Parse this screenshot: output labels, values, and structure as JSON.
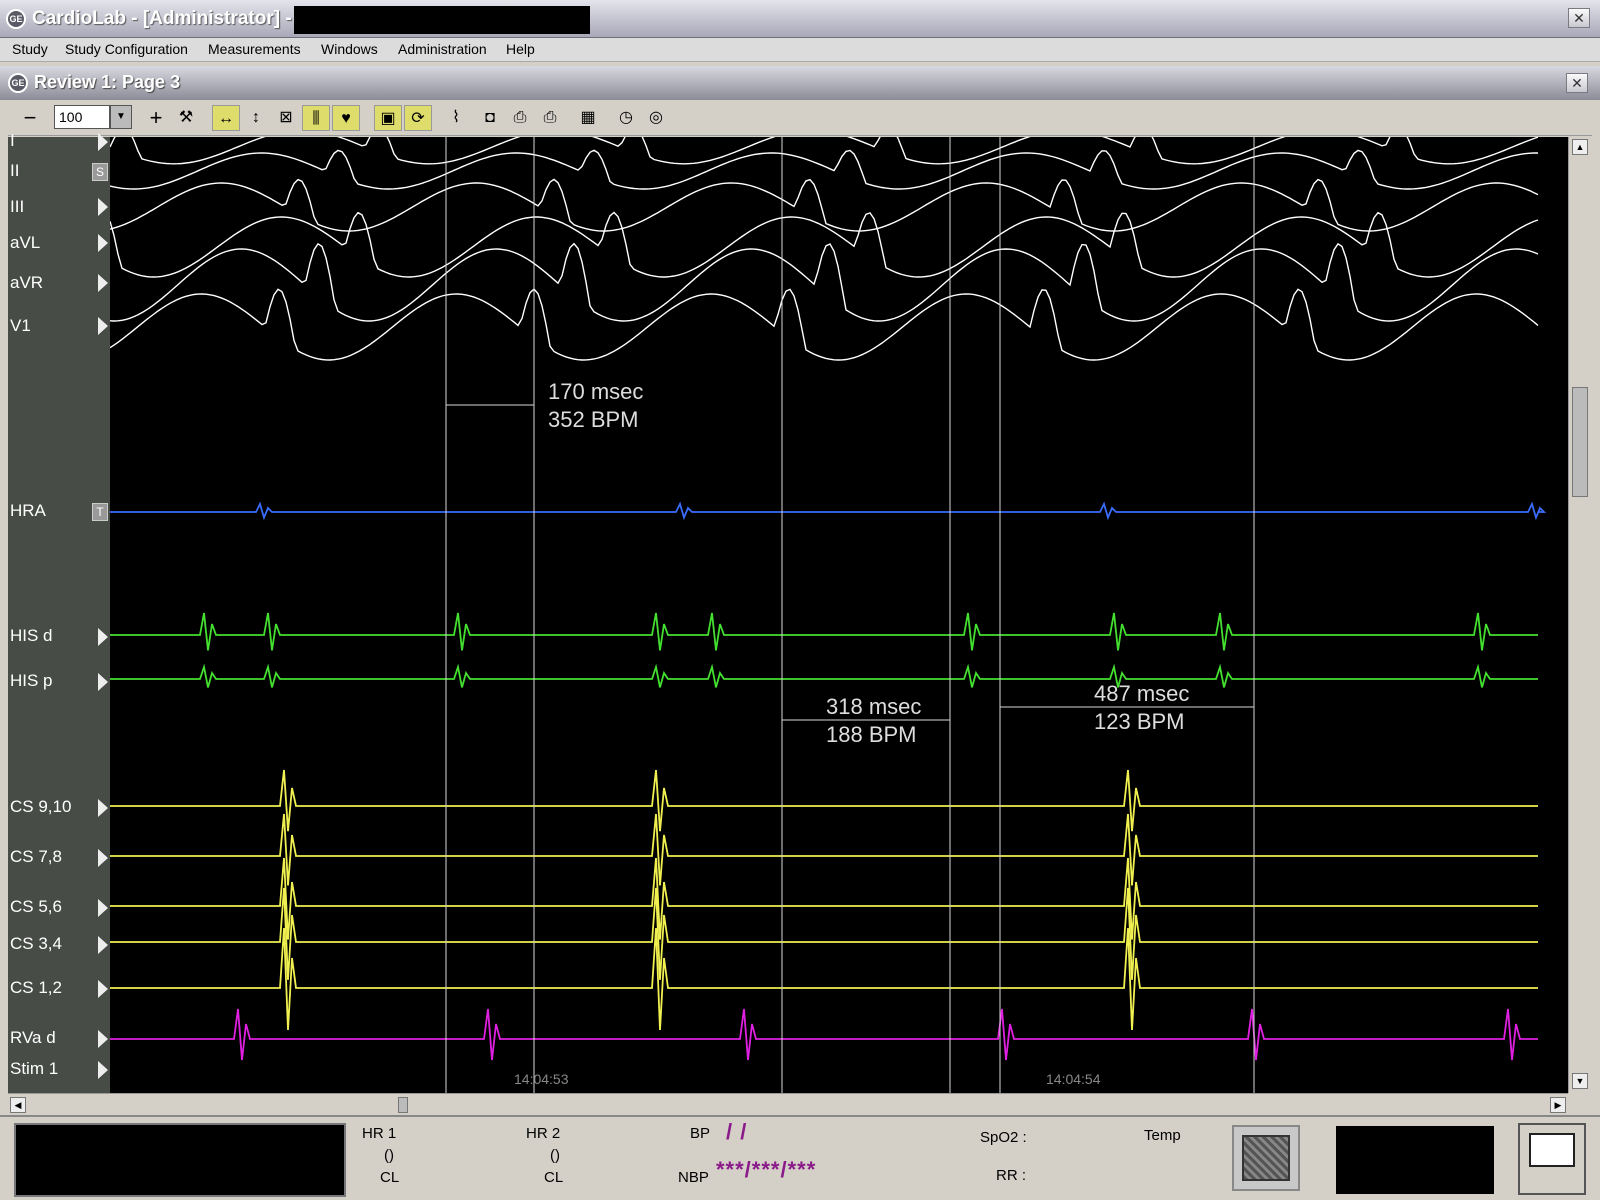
{
  "window": {
    "title": "CardioLab - [Administrator] -",
    "close_symbol": "✕"
  },
  "menu": [
    "Study",
    "Study Configuration",
    "Measurements",
    "Windows",
    "Administration",
    "Help"
  ],
  "review": {
    "title": "Review 1: Page 3",
    "close_symbol": "✕"
  },
  "toolbar": {
    "zoom_value": "100",
    "minus": "−",
    "plus": "+"
  },
  "channels": [
    {
      "label": "I",
      "marker": "tri"
    },
    {
      "label": "II",
      "marker": "box",
      "marker_text": "S"
    },
    {
      "label": "III",
      "marker": "tri"
    },
    {
      "label": "aVL",
      "marker": "tri"
    },
    {
      "label": "aVR",
      "marker": "tri"
    },
    {
      "label": "V1",
      "marker": "tri"
    },
    {
      "label": "HRA",
      "marker": "box",
      "marker_text": "T"
    },
    {
      "label": "HIS d",
      "marker": "tri"
    },
    {
      "label": "HIS p",
      "marker": "tri"
    },
    {
      "label": "CS 9,10",
      "marker": "tri"
    },
    {
      "label": "CS 7,8",
      "marker": "tri"
    },
    {
      "label": "CS 5,6",
      "marker": "tri"
    },
    {
      "label": "CS 3,4",
      "marker": "tri"
    },
    {
      "label": "CS 1,2",
      "marker": "tri"
    },
    {
      "label": "RVa d",
      "marker": "tri"
    },
    {
      "label": "Stim 1",
      "marker": "tri"
    }
  ],
  "colors": {
    "surface_ecg": "#ffffff",
    "hra": "#3a6cff",
    "his": "#44e030",
    "cs": "#f0f050",
    "rva": "#e020e0",
    "calipers": "#d8d8d8"
  },
  "measurements": [
    {
      "msec": "170 msec",
      "bpm": "352 BPM"
    },
    {
      "msec": "318 msec",
      "bpm": "188 BPM"
    },
    {
      "msec": "487 msec",
      "bpm": "123 BPM"
    }
  ],
  "timestamps": [
    "14:04:53",
    "14:04:54"
  ],
  "status": {
    "hr1": {
      "label": "HR 1",
      "value": "()",
      "cl": "CL"
    },
    "hr2": {
      "label": "HR 2",
      "value": "()",
      "cl": "CL"
    },
    "bp": {
      "label": "BP",
      "value": "/ /"
    },
    "nbp": {
      "label": "NBP",
      "value": "***/***/***"
    },
    "spo2": {
      "label": "SpO2 :"
    },
    "temp": {
      "label": "Temp"
    },
    "rr": {
      "label": "RR :"
    }
  }
}
